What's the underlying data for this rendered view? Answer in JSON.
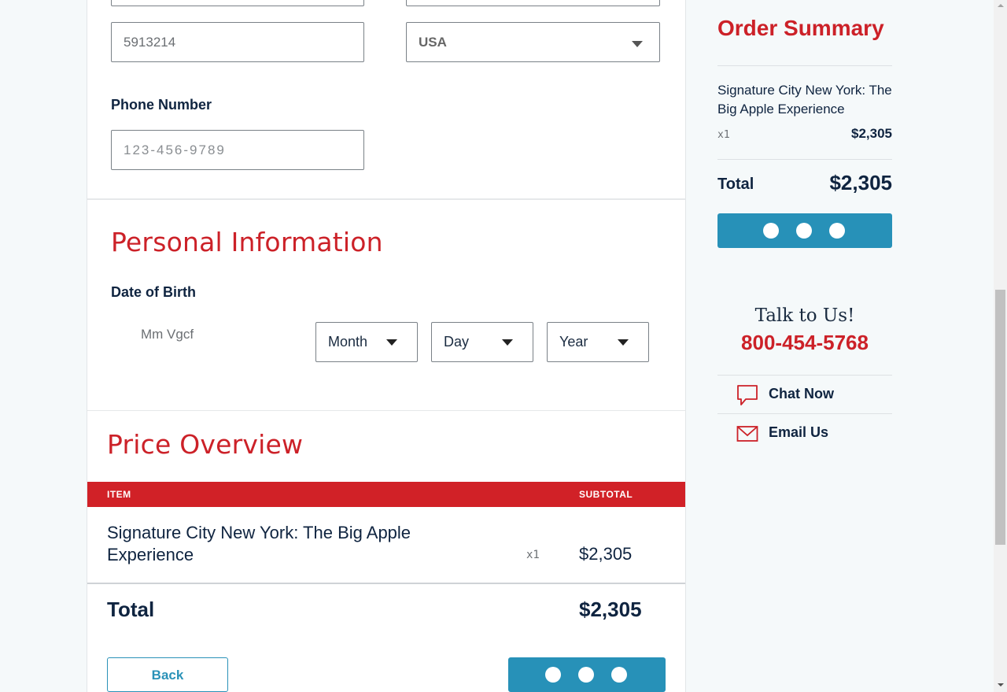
{
  "address": {
    "zip_value": "5913214",
    "country_value": "USA"
  },
  "phone": {
    "label": "Phone Number",
    "placeholder": "123-456-9789"
  },
  "personal": {
    "title": "Personal Information",
    "dob_label": "Date of Birth",
    "dob_hint": "Mm Vgcf",
    "month": "Month",
    "day": "Day",
    "year": "Year"
  },
  "price_overview": {
    "title": "Price Overview",
    "col_item": "ITEM",
    "col_subtotal": "SUBTOTAL",
    "item_name": "Signature City New York: The Big Apple Experience",
    "item_qty": "x1",
    "item_price": "$2,305",
    "total_label": "Total",
    "total_value": "$2,305",
    "back_label": "Back"
  },
  "order_summary": {
    "title": "Order Summary",
    "item_name": "Signature City New York: The Big Apple Experience",
    "item_qty": "x1",
    "item_price": "$2,305",
    "total_label": "Total",
    "total_value": "$2,305"
  },
  "contact": {
    "talk_label": "Talk to Us!",
    "phone": "800-454-5768",
    "chat_label": "Chat Now",
    "email_label": "Email Us"
  },
  "colors": {
    "brand_red": "#cc2128",
    "accent_blue": "#2791b8",
    "navy": "#0f2440"
  }
}
